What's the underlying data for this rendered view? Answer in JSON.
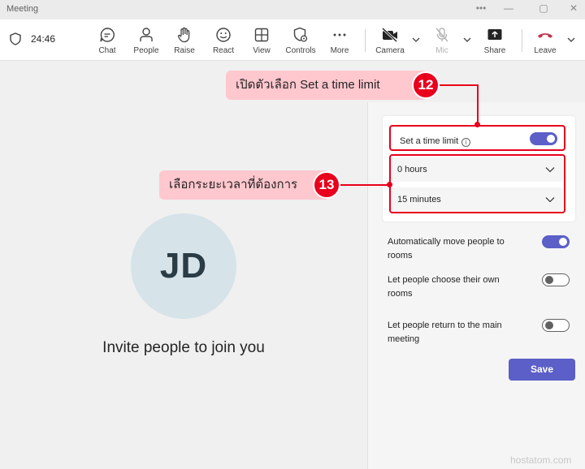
{
  "window": {
    "title": "Meeting",
    "controls": [
      "•••",
      "—",
      "▢",
      "✕"
    ]
  },
  "toolbar": {
    "timer": "24:46",
    "buttons": [
      {
        "label": "Chat",
        "icon": "chat-icon"
      },
      {
        "label": "People",
        "icon": "people-icon"
      },
      {
        "label": "Raise",
        "icon": "raise-hand-icon"
      },
      {
        "label": "React",
        "icon": "react-icon"
      },
      {
        "label": "View",
        "icon": "view-icon"
      },
      {
        "label": "Controls",
        "icon": "controls-icon"
      },
      {
        "label": "More",
        "icon": "more-icon"
      }
    ],
    "camera": "Camera",
    "mic": "Mic",
    "share": "Share",
    "leave": "Leave"
  },
  "stage": {
    "avatar_initials": "JD",
    "invite_text": "Invite people to join you"
  },
  "panel": {
    "time_limit_label": "Set a time limit",
    "time_limit_on": true,
    "hours": "0 hours",
    "minutes": "15 minutes",
    "options": [
      {
        "label": "Automatically move people to rooms",
        "on": true
      },
      {
        "label": "Let people choose their own rooms",
        "on": false
      },
      {
        "label": "Let people return to the main meeting",
        "on": false
      }
    ],
    "save": "Save"
  },
  "annotations": {
    "step12": {
      "number": "12",
      "text": "เปิดตัวเลือก Set a time limit"
    },
    "step13": {
      "number": "13",
      "text": "เลือกระยะเวลาที่ต้องการ"
    }
  },
  "watermark": "hostatom.com",
  "colors": {
    "accent": "#5b5fc7",
    "annotation_red": "#e8001c",
    "callout_bg": "#ffc7ce",
    "leave_red": "#c4314b"
  }
}
